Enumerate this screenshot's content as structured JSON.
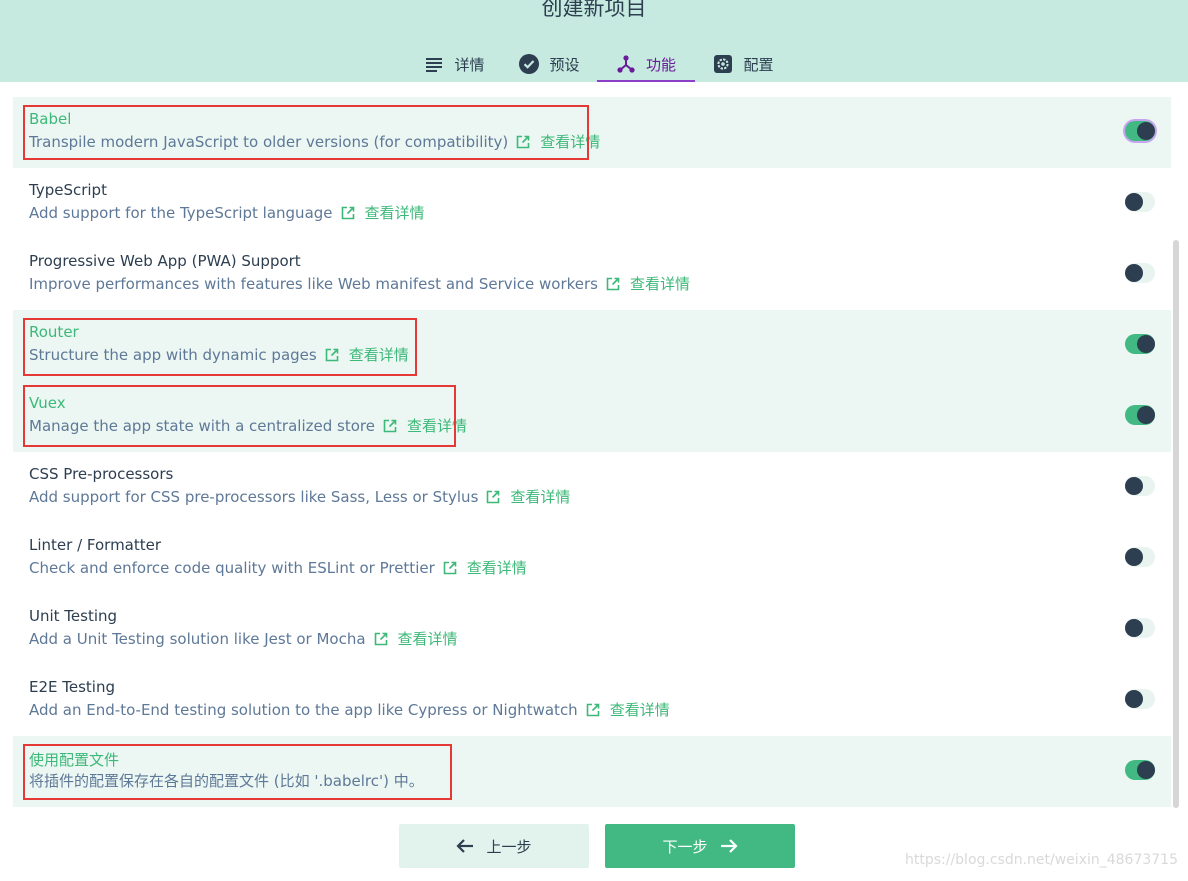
{
  "header": {
    "title": "创建新项目",
    "tabs": [
      {
        "label": "详情",
        "icon": "list-icon"
      },
      {
        "label": "预设",
        "icon": "check-circle-icon"
      },
      {
        "label": "功能",
        "icon": "fork-icon",
        "active": true
      },
      {
        "label": "配置",
        "icon": "settings-icon"
      }
    ]
  },
  "features": [
    {
      "name": "Babel",
      "desc": "Transpile modern JavaScript to older versions (for compatibility)",
      "link": "查看详情",
      "enabled": true
    },
    {
      "name": "TypeScript",
      "desc": "Add support for the TypeScript language",
      "link": "查看详情",
      "enabled": false
    },
    {
      "name": "Progressive Web App (PWA) Support",
      "desc": "Improve performances with features like Web manifest and Service workers",
      "link": "查看详情",
      "enabled": false
    },
    {
      "name": "Router",
      "desc": "Structure the app with dynamic pages",
      "link": "查看详情",
      "enabled": true
    },
    {
      "name": "Vuex",
      "desc": "Manage the app state with a centralized store",
      "link": "查看详情",
      "enabled": true
    },
    {
      "name": "CSS Pre-processors",
      "desc": "Add support for CSS pre-processors like Sass, Less or Stylus",
      "link": "查看详情",
      "enabled": false
    },
    {
      "name": "Linter / Formatter",
      "desc": "Check and enforce code quality with ESLint or Prettier",
      "link": "查看详情",
      "enabled": false
    },
    {
      "name": "Unit Testing",
      "desc": "Add a Unit Testing solution like Jest or Mocha",
      "link": "查看详情",
      "enabled": false
    },
    {
      "name": "E2E Testing",
      "desc": "Add an End-to-End testing solution to the app like Cypress or Nightwatch",
      "link": "查看详情",
      "enabled": false
    },
    {
      "name": "使用配置文件",
      "desc": "将插件的配置保存在各自的配置文件 (比如 '.babelrc') 中。",
      "link": "",
      "enabled": true
    }
  ],
  "buttons": {
    "prev": "上一步",
    "next": "下一步"
  },
  "watermark": "https://blog.csdn.net/weixin_48673715",
  "colors": {
    "header_bg": "#c6eadf",
    "accent": "#42b983",
    "active_tab": "#8e3fc7",
    "highlight_box": "#e53935"
  }
}
